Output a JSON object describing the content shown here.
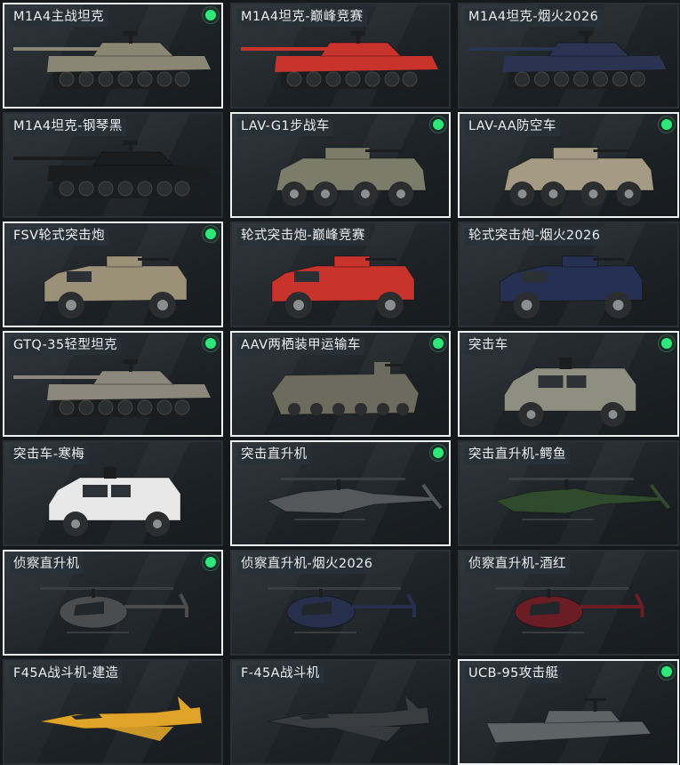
{
  "vehicles": [
    {
      "name": "M1A4主战坦克",
      "icon": "tank-icon",
      "kind": "tank",
      "skin": "#8a8674",
      "selected": true,
      "owned": true
    },
    {
      "name": "M1A4坦克-巅峰竞赛",
      "icon": "tank-icon",
      "kind": "tank",
      "skin": "#c8332b",
      "selected": false,
      "owned": false
    },
    {
      "name": "M1A4坦克-烟火2026",
      "icon": "tank-icon",
      "kind": "tank",
      "skin": "#2a3452",
      "selected": false,
      "owned": false
    },
    {
      "name": "M1A4坦克-钢琴黑",
      "icon": "tank-icon",
      "kind": "tank",
      "skin": "#1a1c1e",
      "selected": false,
      "owned": false
    },
    {
      "name": "LAV-G1步战车",
      "icon": "ifv-icon",
      "kind": "lav",
      "skin": "#7b7d6a",
      "selected": true,
      "owned": true
    },
    {
      "name": "LAV-AA防空车",
      "icon": "aa-vehicle-icon",
      "kind": "lav",
      "skin": "#a59a84",
      "selected": true,
      "owned": true
    },
    {
      "name": "FSV轮式突击炮",
      "icon": "wheeled-gun-icon",
      "kind": "wheeled",
      "skin": "#9b9078",
      "selected": true,
      "owned": true
    },
    {
      "name": "轮式突击炮-巅峰竞赛",
      "icon": "wheeled-gun-icon",
      "kind": "wheeled",
      "skin": "#c8332b",
      "selected": false,
      "owned": false
    },
    {
      "name": "轮式突击炮-烟火2026",
      "icon": "wheeled-gun-icon",
      "kind": "wheeled",
      "skin": "#263052",
      "selected": false,
      "owned": false
    },
    {
      "name": "GTQ-35轻型坦克",
      "icon": "light-tank-icon",
      "kind": "tank",
      "skin": "#8b887b",
      "selected": true,
      "owned": true
    },
    {
      "name": "AAV两栖装甲运输车",
      "icon": "amphibious-vehicle-icon",
      "kind": "aav",
      "skin": "#6d6b5e",
      "selected": true,
      "owned": true
    },
    {
      "name": "突击车",
      "icon": "assault-vehicle-icon",
      "kind": "assault",
      "skin": "#8e8f80",
      "selected": true,
      "owned": true
    },
    {
      "name": "突击车-寒梅",
      "icon": "assault-vehicle-icon",
      "kind": "assault",
      "skin": "#e8e8e8",
      "selected": false,
      "owned": false
    },
    {
      "name": "突击直升机",
      "icon": "attack-helicopter-icon",
      "kind": "attackheli",
      "skin": "#55585a",
      "selected": true,
      "owned": true
    },
    {
      "name": "突击直升机-鳄鱼",
      "icon": "attack-helicopter-icon",
      "kind": "attackheli",
      "skin": "#2f4a2c",
      "selected": false,
      "owned": false
    },
    {
      "name": "侦察直升机",
      "icon": "scout-helicopter-icon",
      "kind": "scoutheli",
      "skin": "#4a4c4e",
      "selected": true,
      "owned": true
    },
    {
      "name": "侦察直升机-烟火2026",
      "icon": "scout-helicopter-icon",
      "kind": "scoutheli",
      "skin": "#26304c",
      "selected": false,
      "owned": false
    },
    {
      "name": "侦察直升机-酒红",
      "icon": "scout-helicopter-icon",
      "kind": "scoutheli",
      "skin": "#6a1d24",
      "selected": false,
      "owned": false
    },
    {
      "name": "F45A战斗机-建造",
      "icon": "jet-fighter-icon",
      "kind": "jet",
      "skin": "#e0a428",
      "selected": false,
      "owned": false
    },
    {
      "name": "F-45A战斗机",
      "icon": "jet-fighter-icon",
      "kind": "jet",
      "skin": "#3a3d40",
      "selected": false,
      "owned": false
    },
    {
      "name": "UCB-95攻击艇",
      "icon": "attack-boat-icon",
      "kind": "boat",
      "skin": "#5e6366",
      "selected": true,
      "owned": true
    }
  ]
}
